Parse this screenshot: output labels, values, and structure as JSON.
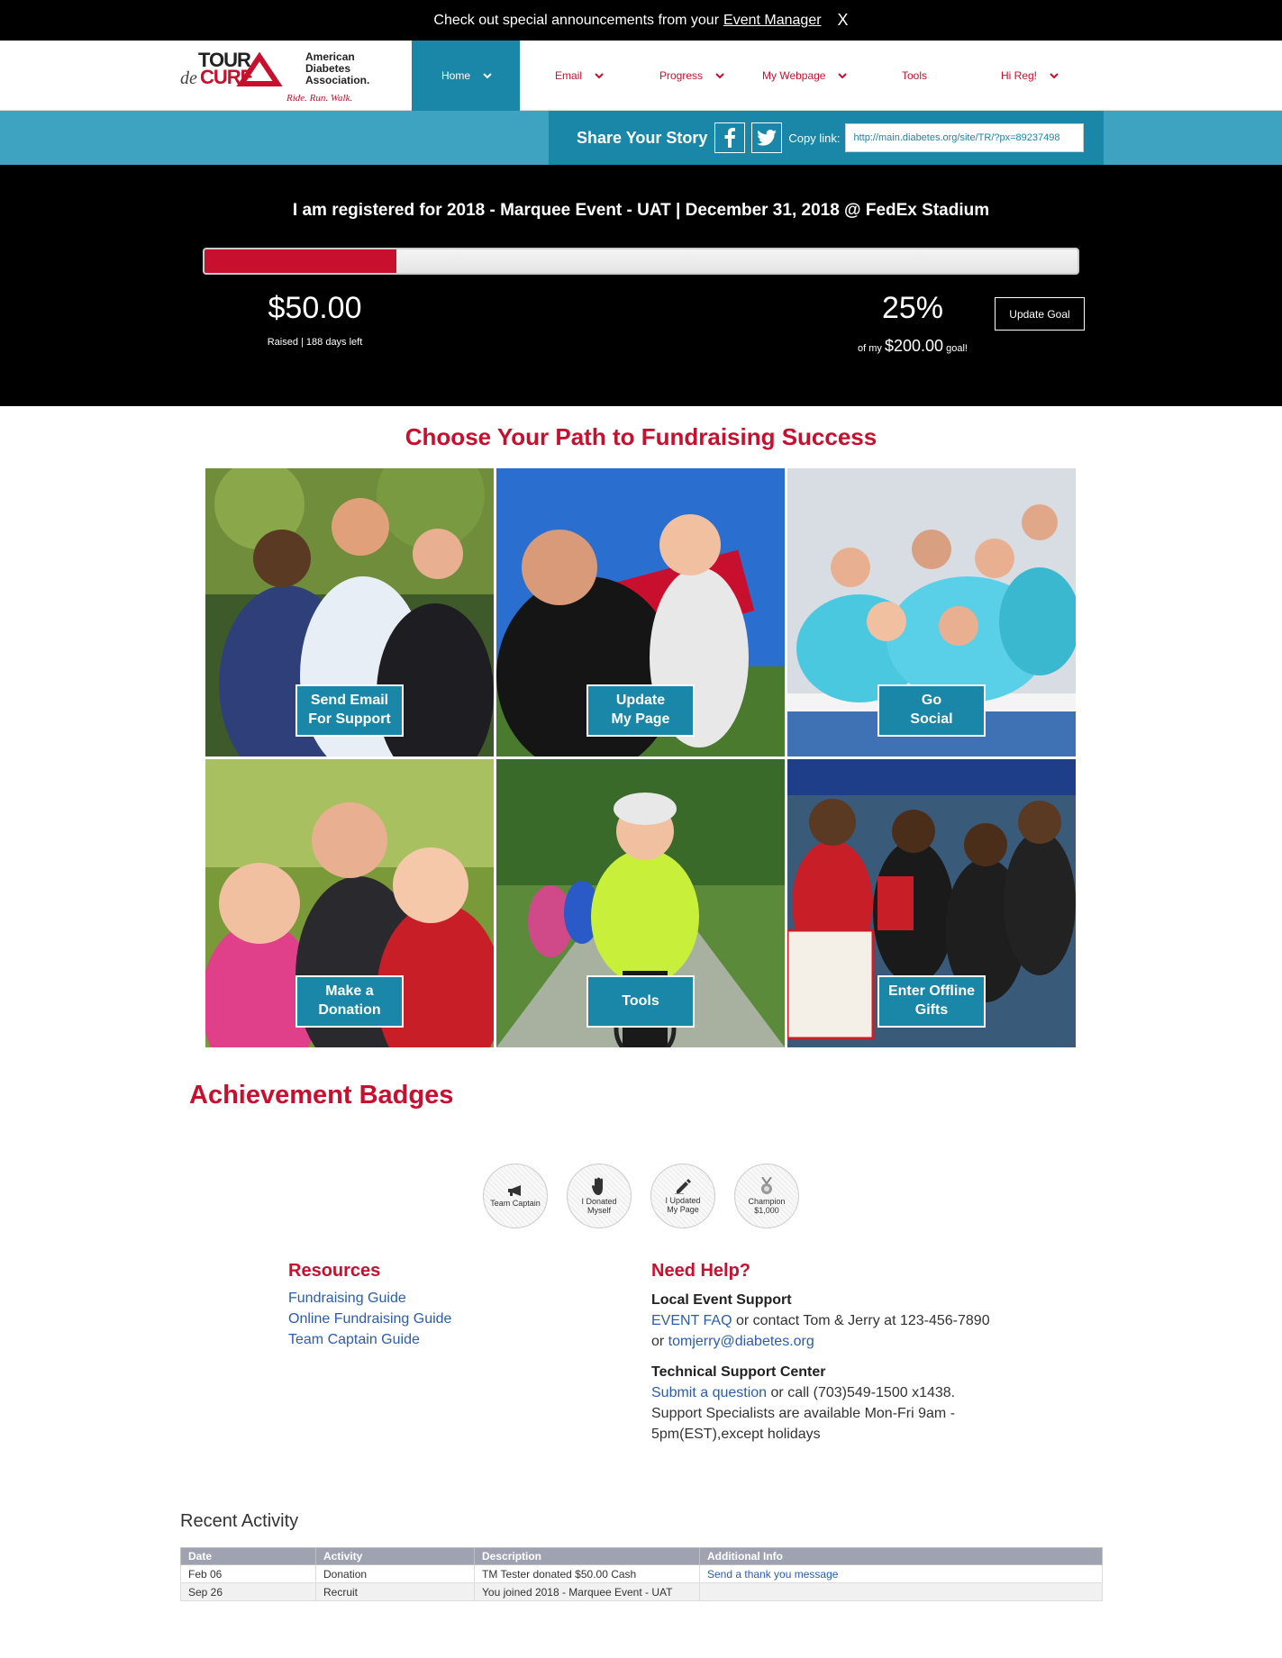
{
  "announcement": {
    "text": "Check out special announcements from your",
    "link": "Event Manager",
    "close": "X"
  },
  "logo": {
    "brand_top": "TOUR",
    "brand_mid": "de",
    "brand_bottom": "CURE",
    "org": "American Diabetes Association.",
    "org_line1": "American",
    "org_line2": "Diabetes",
    "org_line3": "Association.",
    "tagline": "Ride. Run. Walk."
  },
  "nav": {
    "items": [
      "Home",
      "Email",
      "Progress",
      "My Webpage",
      "Tools",
      "Hi Reg!"
    ]
  },
  "share": {
    "title": "Share Your Story",
    "copy_label": "Copy link:",
    "copy_value": "http://main.diabetes.org/site/TR/?px=89237498",
    "icons": [
      "facebook-icon",
      "twitter-icon"
    ]
  },
  "hero": {
    "registration": "I am registered for 2018 - Marquee Event - UAT | December 31, 2018 @ FedEx Stadium",
    "progress_fraction": 0.22,
    "raised": "$50.00",
    "raised_sub": "Raised | 188 days left",
    "percent": "25%",
    "goal_prefix": "of my",
    "goal_amount": "$200.00",
    "goal_suffix": "goal!",
    "update_goal": "Update Goal"
  },
  "path": {
    "title": "Choose Your Path to Fundraising Success",
    "tiles": [
      {
        "line1": "Send Email",
        "line2": "For Support"
      },
      {
        "line1": "Update",
        "line2": "My Page"
      },
      {
        "line1": "Go",
        "line2": "Social"
      },
      {
        "line1": "Make a",
        "line2": "Donation"
      },
      {
        "line1": "Tools",
        "line2": ""
      },
      {
        "line1": "Enter Offline",
        "line2": "Gifts"
      }
    ]
  },
  "badges": {
    "title": "Achievement Badges",
    "items": [
      {
        "line1": "Team Captain",
        "line2": "",
        "icon": "megaphone-icon"
      },
      {
        "line1": "I Donated",
        "line2": "Myself",
        "icon": "hand-icon"
      },
      {
        "line1": "I Updated",
        "line2": "My Page",
        "icon": "pen-icon"
      },
      {
        "line1": "Champion",
        "line2": "$1,000",
        "icon": "medal-icon"
      }
    ]
  },
  "resources": {
    "title": "Resources",
    "links": [
      "Fundraising Guide",
      "Online Fundraising Guide",
      "Team Captain Guide"
    ]
  },
  "help": {
    "title": "Need Help?",
    "local_title": "Local Event Support",
    "faq_link": "EVENT FAQ",
    "contact_text": " or contact Tom & Jerry at 123-456-7890",
    "or_text": "or ",
    "email_link": "tomjerry@diabetes.org",
    "tech_title": "Technical Support Center",
    "submit_link": "Submit a question",
    "call_text": " or call (703)549-1500 x1438.",
    "hours_line1": "Support Specialists are available Mon-Fri 9am -",
    "hours_line2": "5pm(EST),except holidays"
  },
  "activity": {
    "title": "Recent Activity",
    "headers": [
      "Date",
      "Activity",
      "Description",
      "Additional Info"
    ],
    "rows": [
      [
        "Feb 06",
        "Donation",
        "TM Tester donated $50.00 Cash",
        "Send a thank you message"
      ],
      [
        "Sep 26",
        "Recruit",
        "You joined 2018 - Marquee Event - UAT",
        ""
      ]
    ]
  },
  "colors": {
    "brand_red": "#c8102e",
    "teal": "#1a86a8",
    "light_teal": "#3ea3c0"
  }
}
